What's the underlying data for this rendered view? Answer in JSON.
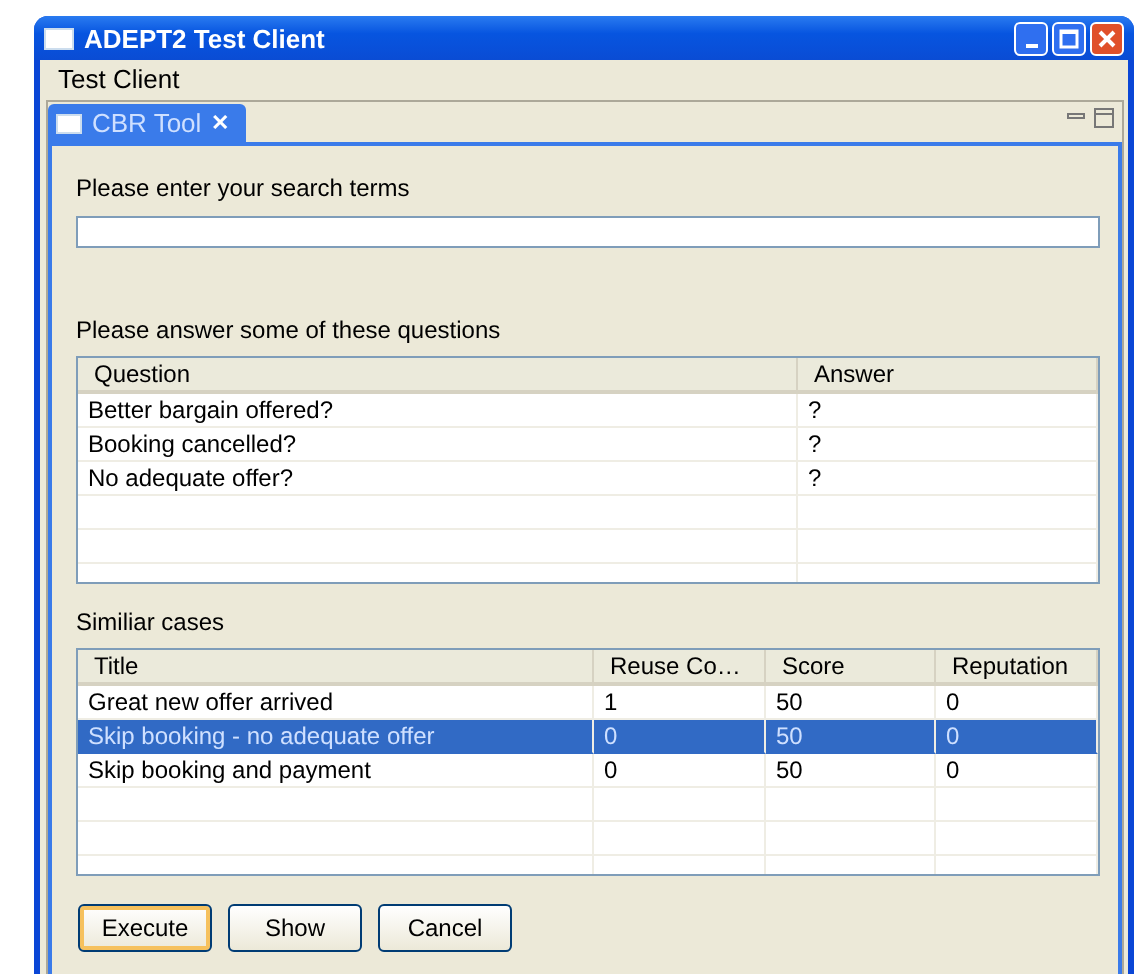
{
  "window": {
    "title": "ADEPT2 Test Client"
  },
  "menu": [
    "Test Client"
  ],
  "tabs": [
    {
      "label": "CBR Tool",
      "close": "✕",
      "selected": true
    }
  ],
  "search": {
    "label": "Please enter your search terms"
  },
  "questions": {
    "label": "Please answer some of these questions",
    "columns": [
      "Question",
      "Answer"
    ],
    "rows": [
      {
        "question": "Better bargain offered?",
        "answer": "?"
      },
      {
        "question": "Booking cancelled?",
        "answer": "?"
      },
      {
        "question": "No adequate offer?",
        "answer": "?"
      }
    ]
  },
  "cases": {
    "label": "Similiar cases",
    "columns": [
      "Title",
      "Reuse Co…",
      "Score",
      "Reputation"
    ],
    "rows": [
      {
        "cells": [
          "Great new offer arrived",
          "1",
          "50",
          "0"
        ],
        "selected": false
      },
      {
        "cells": [
          "Skip booking - no adequate offer",
          "0",
          "50",
          "0"
        ],
        "selected": true
      },
      {
        "cells": [
          "Skip booking and payment",
          "0",
          "50",
          "0"
        ],
        "selected": false
      }
    ]
  },
  "buttons": [
    {
      "label": "Execute",
      "default": true
    },
    {
      "label": "Show",
      "default": false
    },
    {
      "label": "Cancel",
      "default": false
    }
  ]
}
